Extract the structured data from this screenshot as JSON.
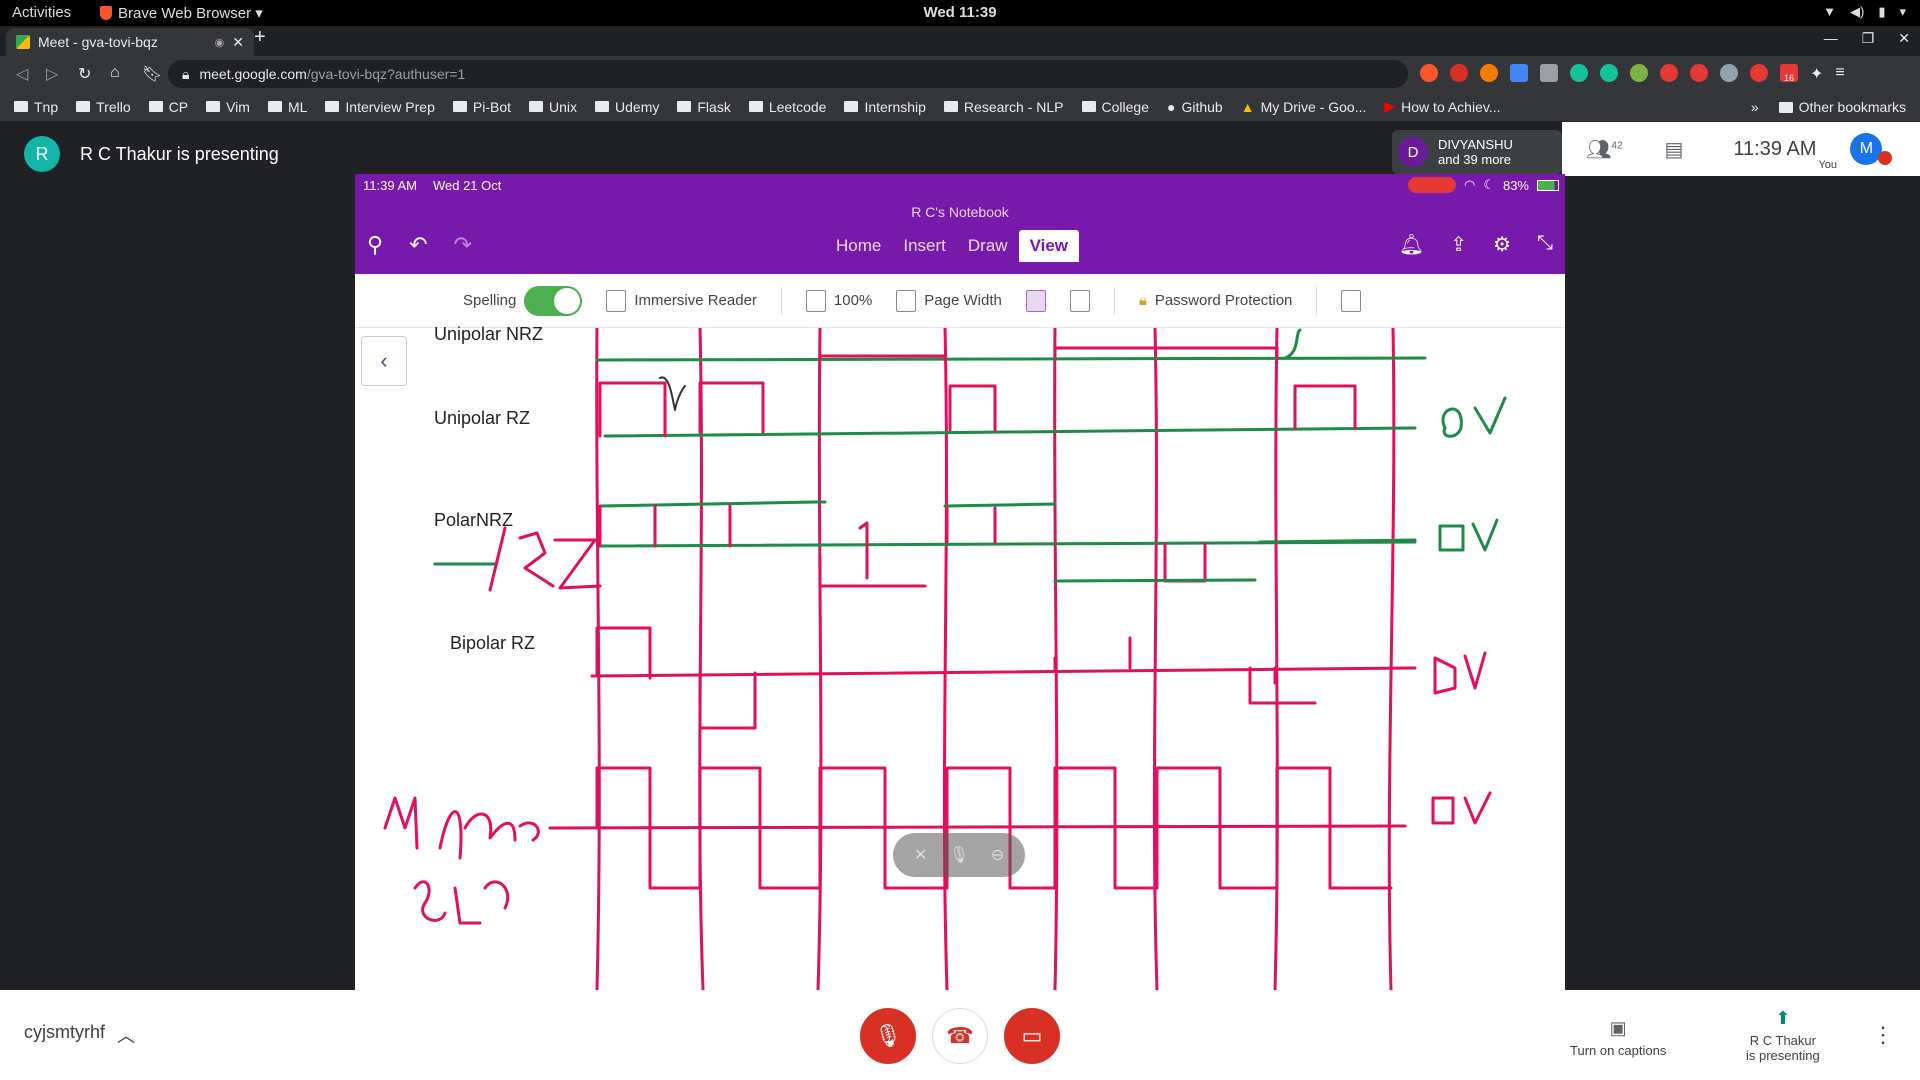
{
  "topbar": {
    "activities": "Activities",
    "app": "Brave Web Browser ▾",
    "clock": "Wed 11:39"
  },
  "browser": {
    "tab_title": "Meet - gva-tovi-bqz",
    "url_host": "meet.google.com",
    "url_path": "/gva-tovi-bqz?authuser=1",
    "bookmarks": [
      "Tnp",
      "Trello",
      "CP",
      "Vim",
      "ML",
      "Interview Prep",
      "Pi-Bot",
      "Unix",
      "Udemy",
      "Flask",
      "Leetcode",
      "Internship",
      "Research - NLP",
      "College",
      "Github",
      "My Drive - Goo...",
      "How to Achiev..."
    ],
    "more_chevron": "»",
    "other_bookmarks": "Other bookmarks",
    "ext_badge": "16"
  },
  "meet": {
    "presenter_initial": "R",
    "presenting_text": "R C Thakur is presenting",
    "participant_initial": "D",
    "participant_name": "DIVYANSHU",
    "participant_more": "and 39 more",
    "people_count": "42",
    "time": "11:39 AM",
    "me_initial": "M",
    "me_label": "You",
    "meeting_code": "cyjsmtyrhf",
    "captions_label": "Turn on captions",
    "presenting_label_1": "R C Thakur",
    "presenting_label_2": "is presenting"
  },
  "onenote": {
    "status_time": "11:39 AM",
    "status_date": "Wed 21 Oct",
    "battery": "83%",
    "notebook_title": "R C's Notebook",
    "tabs": [
      "Home",
      "Insert",
      "Draw",
      "View"
    ],
    "active_tab": "View",
    "ribbon": {
      "spelling": "Spelling",
      "immersive_reader": "Immersive Reader",
      "zoom": "100%",
      "page_width": "Page Width",
      "password": "Password Protection"
    },
    "labels": {
      "unipolar_nrz": "Unipolar NRZ",
      "unipolar_rz": "Unipolar RZ",
      "polar_nrz": "PolarNRZ",
      "bipolar_rz": "Bipolar RZ"
    }
  },
  "colors": {
    "onenote_purple": "#7719aa",
    "ink_pink": "#e0105e",
    "ink_green": "#1e8c46",
    "meet_red": "#d93025"
  }
}
